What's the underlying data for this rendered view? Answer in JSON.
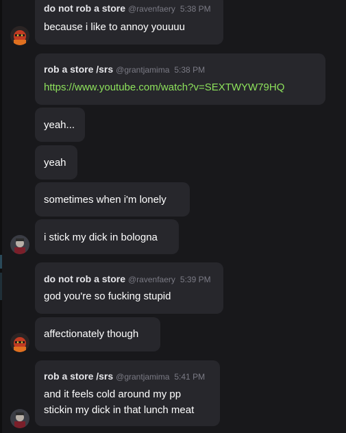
{
  "messages": [
    {
      "author": "do not rob a store",
      "handle": "@ravenfaery",
      "time": "5:38 PM",
      "lines": [
        "because i like to annoy youuuu"
      ]
    },
    {
      "author": "rob a store /srs",
      "handle": "@grantjamima",
      "time": "5:38 PM",
      "lines": [
        "https://www.youtube.com/watch?v=SEXTWYW79HQ"
      ]
    },
    {
      "lines": [
        "yeah..."
      ]
    },
    {
      "lines": [
        "yeah"
      ]
    },
    {
      "lines": [
        "sometimes when i'm lonely"
      ]
    },
    {
      "lines": [
        "i stick my dick in bologna"
      ]
    },
    {
      "author": "do not rob a store",
      "handle": "@ravenfaery",
      "time": "5:39 PM",
      "lines": [
        "god you're so fucking stupid"
      ]
    },
    {
      "lines": [
        "affectionately though"
      ]
    },
    {
      "author": "rob a store /srs",
      "handle": "@grantjamima",
      "time": "5:41 PM",
      "lines": [
        "and it feels cold around my pp",
        "stickin my dick in that lunch meat"
      ]
    }
  ],
  "avatars": {
    "ravenfaery": "red-character-avatar-icon",
    "grantjamima": "gray-character-avatar-icon"
  },
  "colors": {
    "background": "#18181b",
    "bubble": "#27272c",
    "link": "#8ee35c",
    "author": "#e6e6ea",
    "meta": "#7b7b85"
  }
}
